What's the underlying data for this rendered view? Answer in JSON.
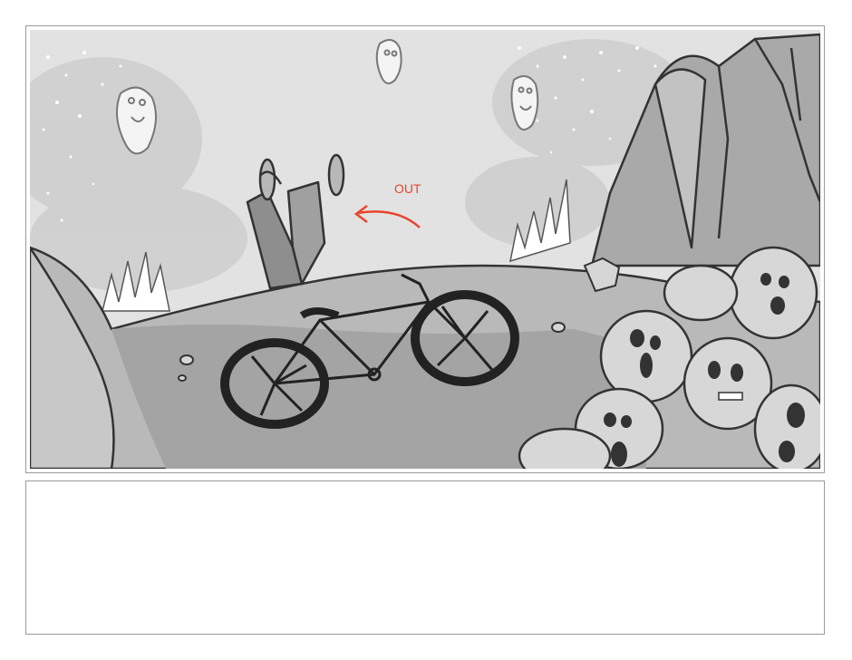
{
  "storyboard": {
    "panel": {
      "direction_note": "OUT",
      "note_color": "#e8452c"
    },
    "notes": {
      "text": ""
    }
  }
}
